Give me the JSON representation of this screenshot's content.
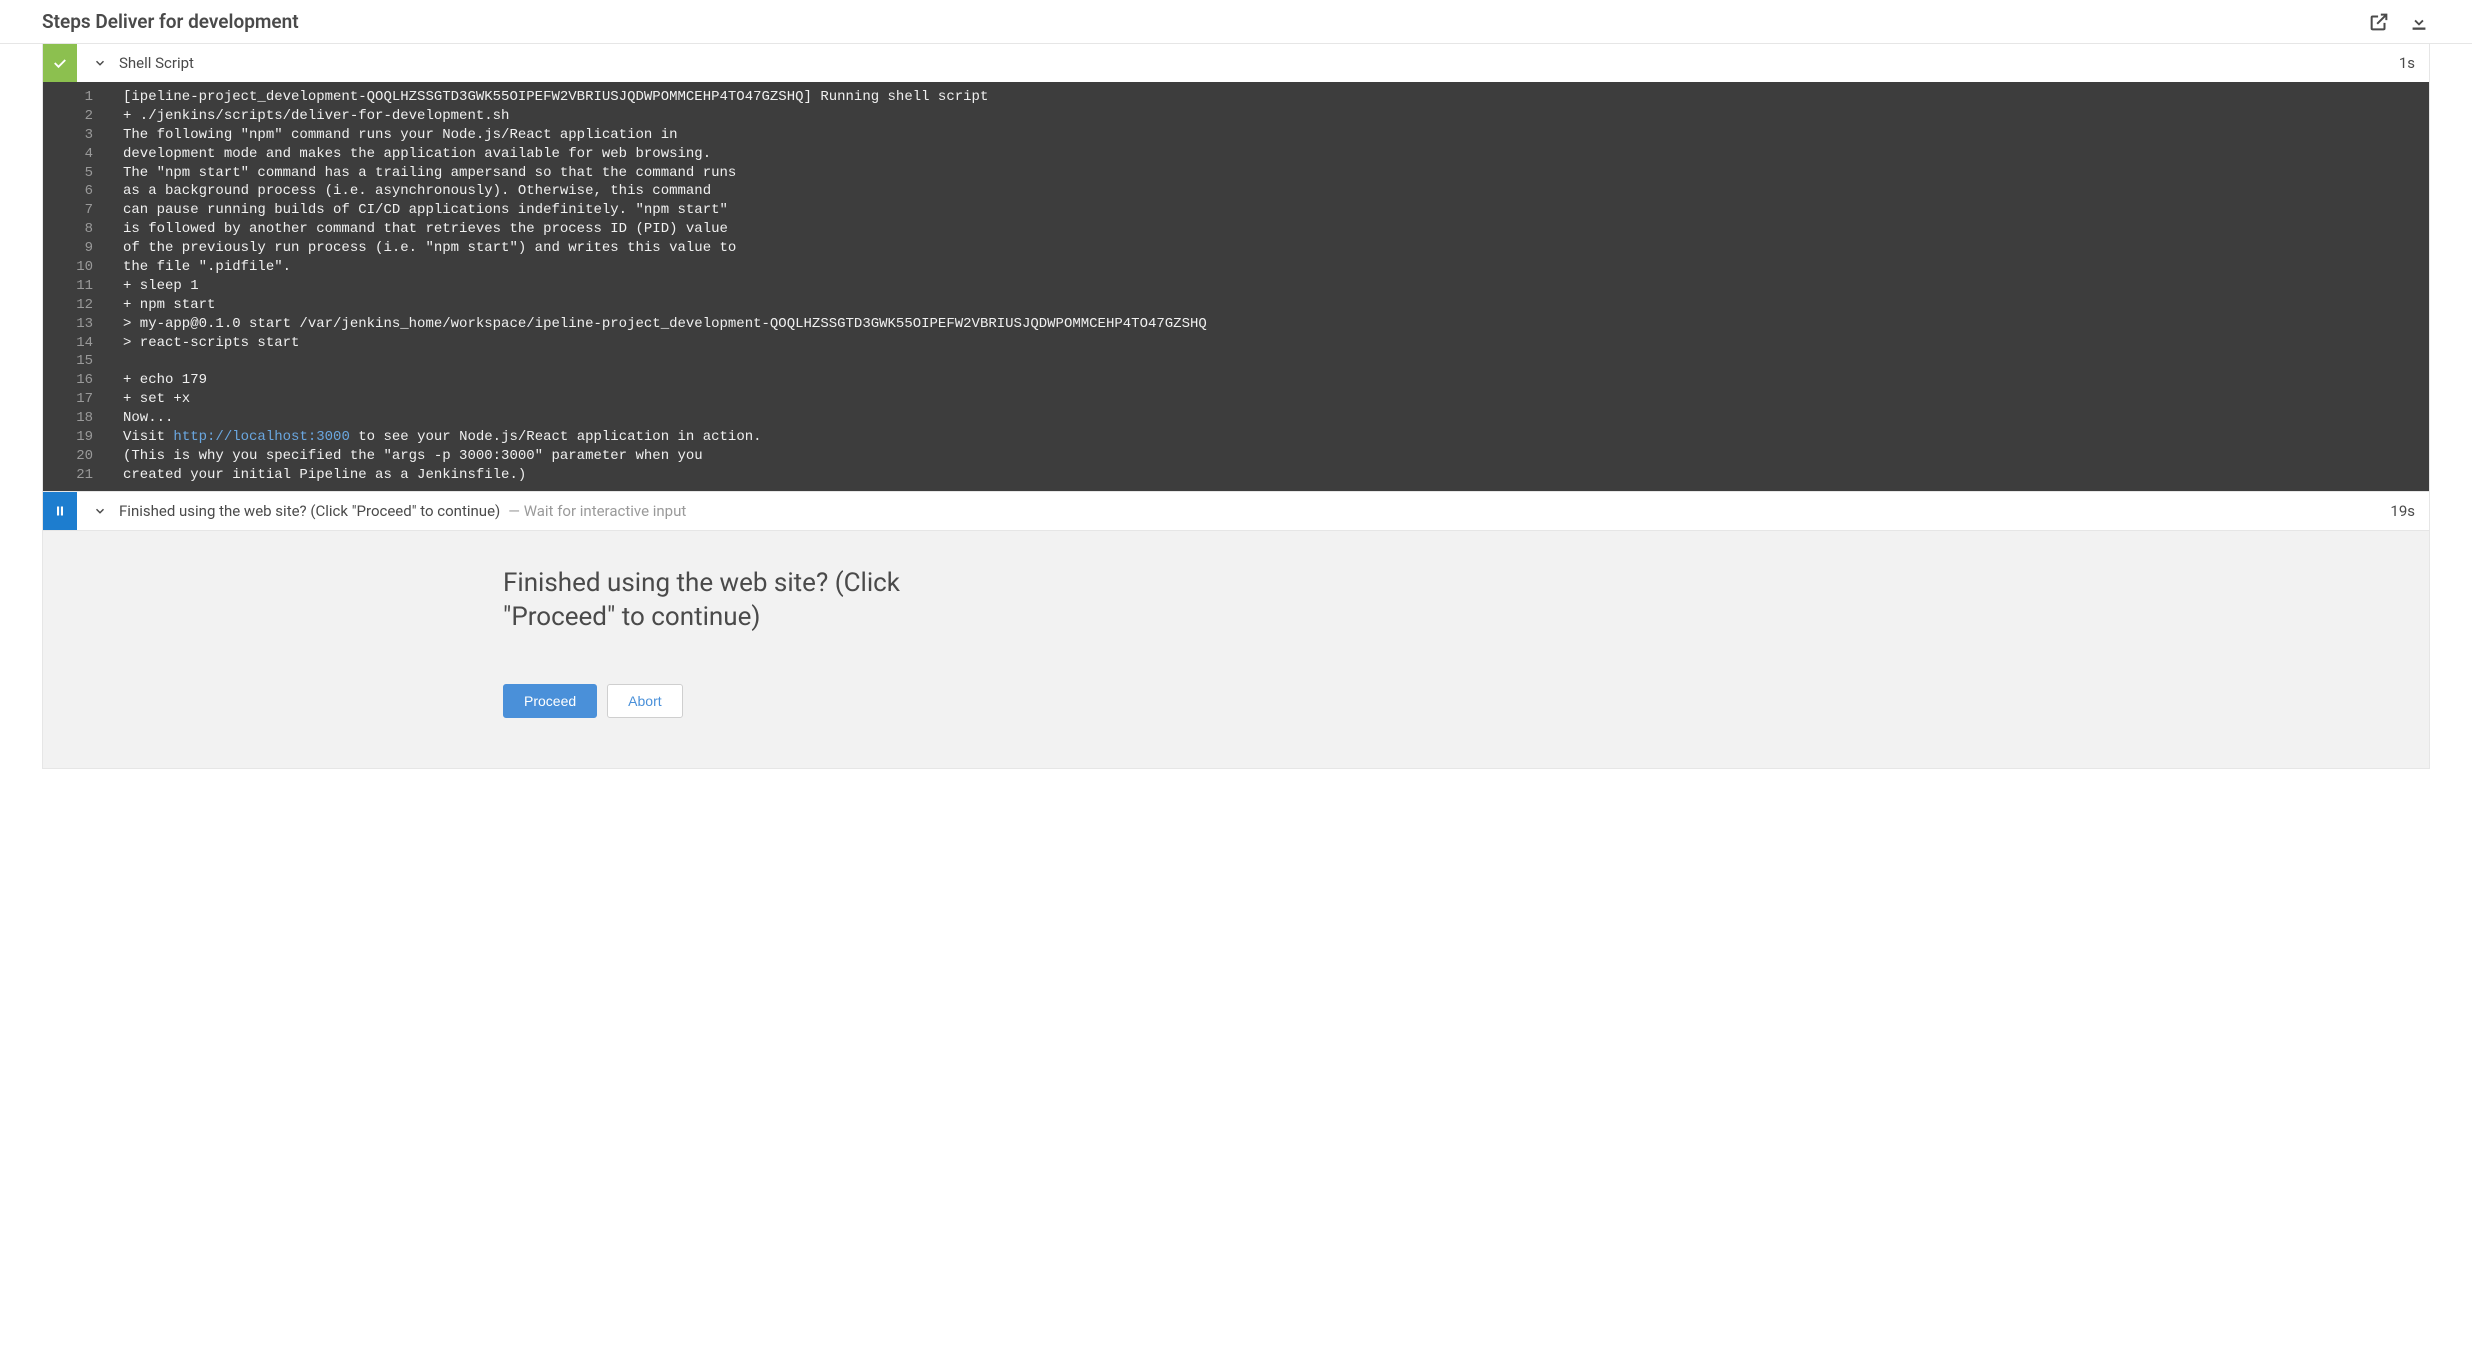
{
  "header": {
    "title": "Steps Deliver for development"
  },
  "steps": [
    {
      "status": "success",
      "title": "Shell Script",
      "duration": "1s",
      "console_lines": [
        "[ipeline-project_development-QOQLHZSSGTD3GWK55OIPEFW2VBRIUSJQDWPOMMCEHP4TO47GZSHQ] Running shell script",
        "+ ./jenkins/scripts/deliver-for-development.sh",
        "The following \"npm\" command runs your Node.js/React application in",
        "development mode and makes the application available for web browsing.",
        "The \"npm start\" command has a trailing ampersand so that the command runs",
        "as a background process (i.e. asynchronously). Otherwise, this command",
        "can pause running builds of CI/CD applications indefinitely. \"npm start\"",
        "is followed by another command that retrieves the process ID (PID) value",
        "of the previously run process (i.e. \"npm start\") and writes this value to",
        "the file \".pidfile\".",
        "+ sleep 1",
        "+ npm start",
        "> my-app@0.1.0 start /var/jenkins_home/workspace/ipeline-project_development-QOQLHZSSGTD3GWK55OIPEFW2VBRIUSJQDWPOMMCEHP4TO47GZSHQ",
        "> react-scripts start",
        "",
        "+ echo 179",
        "+ set +x",
        "Now...",
        "Visit http://localhost:3000 to see your Node.js/React application in action.",
        "(This is why you specified the \"args -p 3000:3000\" parameter when you",
        "created your initial Pipeline as a Jenkinsfile.)"
      ],
      "url_in_line_index": 18,
      "url_text": "http://localhost:3000"
    },
    {
      "status": "running",
      "title": "Finished using the web site? (Click \"Proceed\" to continue)",
      "subtitle_prefix": " — ",
      "subtitle": "Wait for interactive input",
      "duration": "19s"
    }
  ],
  "prompt": {
    "message": "Finished using the web site? (Click \"Proceed\" to continue)",
    "proceed_label": "Proceed",
    "abort_label": "Abort"
  }
}
